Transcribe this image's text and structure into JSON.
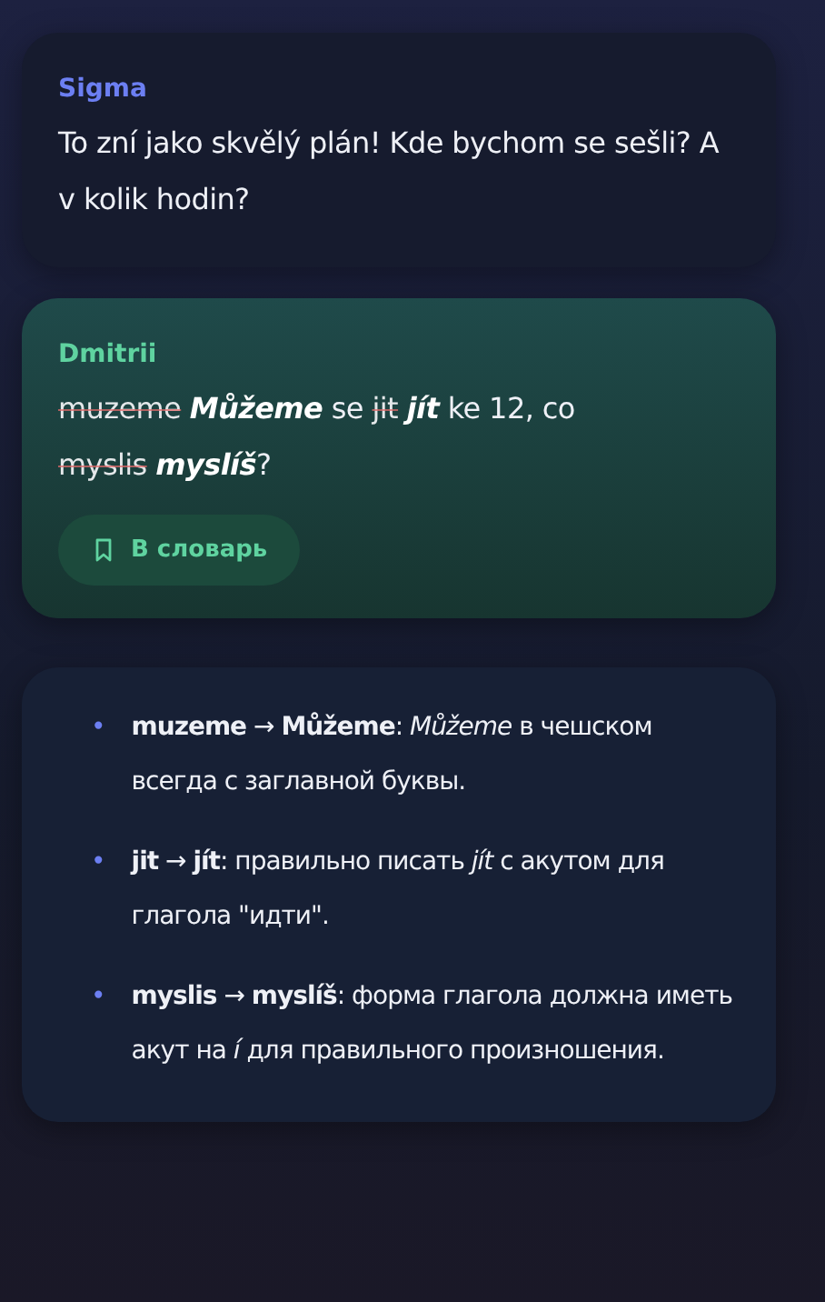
{
  "messages": [
    {
      "author": "Sigma",
      "kind": "incoming",
      "segments": [
        {
          "kind": "plain",
          "text": "To zní jako skvělý plán! Kde bychom se sešli? A v kolik hodin?"
        }
      ]
    },
    {
      "author": "Dmitrii",
      "kind": "own",
      "segments": [
        {
          "kind": "struck",
          "text": "muzeme"
        },
        {
          "kind": "correction",
          "text": "Můžeme"
        },
        {
          "kind": "plain",
          "text": " se "
        },
        {
          "kind": "struck",
          "text": "jit"
        },
        {
          "kind": "correction",
          "text": "jít"
        },
        {
          "kind": "plain",
          "text": " ke 12, co "
        },
        {
          "kind": "struck",
          "text": "myslis"
        },
        {
          "kind": "correction",
          "text": "myslíš"
        },
        {
          "kind": "plain",
          "text": "?"
        }
      ],
      "button": "В словарь"
    }
  ],
  "notes": [
    {
      "marker": "•",
      "text": "**muzeme** → **Můžeme**: *Můžeme* в чешском всегда с заглавной буквы."
    },
    {
      "marker": "•",
      "text": "**jit** → **jít**: правильно писать *jít* с акутом для глагола \"идти\"."
    },
    {
      "marker": "•",
      "text": "**myslis** → **myslíš**: форма глагола должна иметь акут на *í* для правильного произношения."
    }
  ]
}
